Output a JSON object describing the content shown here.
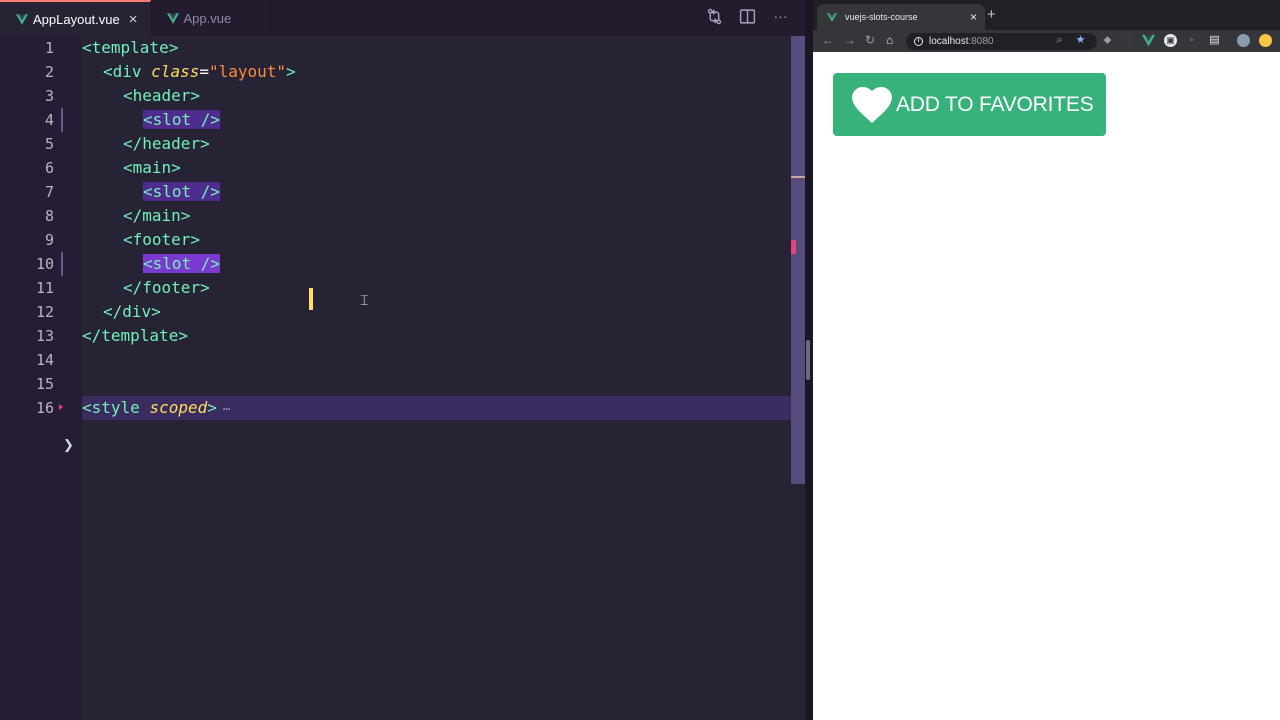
{
  "editor": {
    "tabs": [
      {
        "label": "AppLayout.vue",
        "active": true
      },
      {
        "label": "App.vue",
        "active": false
      }
    ],
    "actions": [
      "compare-changes-icon",
      "split-editor-icon",
      "more-actions-icon"
    ],
    "line_numbers": [
      "1",
      "2",
      "3",
      "4",
      "5",
      "6",
      "7",
      "8",
      "9",
      "10",
      "11",
      "12",
      "13",
      "14",
      "15",
      "16"
    ],
    "lines": [
      {
        "tag_open": "<template>"
      },
      {
        "tag_open": "<div ",
        "attr": "class",
        "eq": "=",
        "value": "\"layout\"",
        "tag_close": ">"
      },
      {
        "tag_open": "<header>"
      },
      {
        "tag_open": "<slot />"
      },
      {
        "tag_open": "</header>"
      },
      {
        "tag_open": "<main>"
      },
      {
        "tag_open": "<slot />"
      },
      {
        "tag_open": "</main>"
      },
      {
        "tag_open": "<footer>"
      },
      {
        "tag_open": "<slot />"
      },
      {
        "tag_open": "</footer>"
      },
      {
        "tag_open": "</div>"
      },
      {
        "tag_open": "</template>"
      },
      {
        "tag_open": ""
      },
      {
        "tag_open": ""
      },
      {
        "tag_open": "<style ",
        "attr": "scoped",
        "tag_close": ">",
        "ellipsis": "⋯"
      }
    ]
  },
  "browser": {
    "tab_title": "vuejs-slots-course",
    "tab_close": "×",
    "new_tab": "+",
    "url_host": "localhost",
    "url_port": ":8080",
    "fav_button_label": "ADD TO FAVORITES"
  },
  "colors": {
    "editor_bg": "#262335",
    "tag": "#72f1b8",
    "attr": "#fede5d",
    "string": "#ff8b39",
    "button_green": "#38b27b"
  }
}
